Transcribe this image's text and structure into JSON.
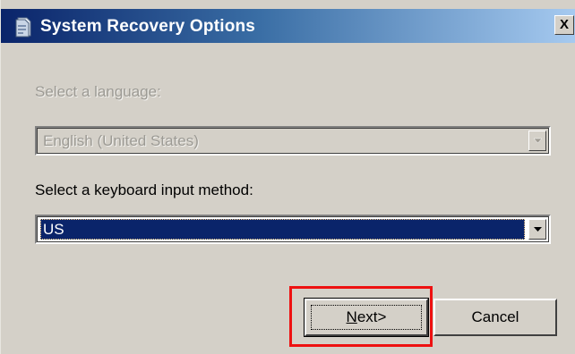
{
  "window": {
    "title": "System Recovery Options",
    "title_icon": "recovery-icon",
    "close_label": "X"
  },
  "language": {
    "label": "Select a language:",
    "value": "English (United States)",
    "enabled": false
  },
  "keyboard": {
    "label": "Select a keyboard input method:",
    "value": "US",
    "enabled": true
  },
  "buttons": {
    "next_label_mnemonic": "N",
    "next_label_rest": "ext>",
    "cancel_label": "Cancel"
  },
  "colors": {
    "title_gradient_start": "#0a246a",
    "title_gradient_end": "#a6caf0",
    "dialog_background": "#d4d0c8",
    "selection_background": "#0a246a",
    "highlight_annotation": "#ee1111"
  }
}
